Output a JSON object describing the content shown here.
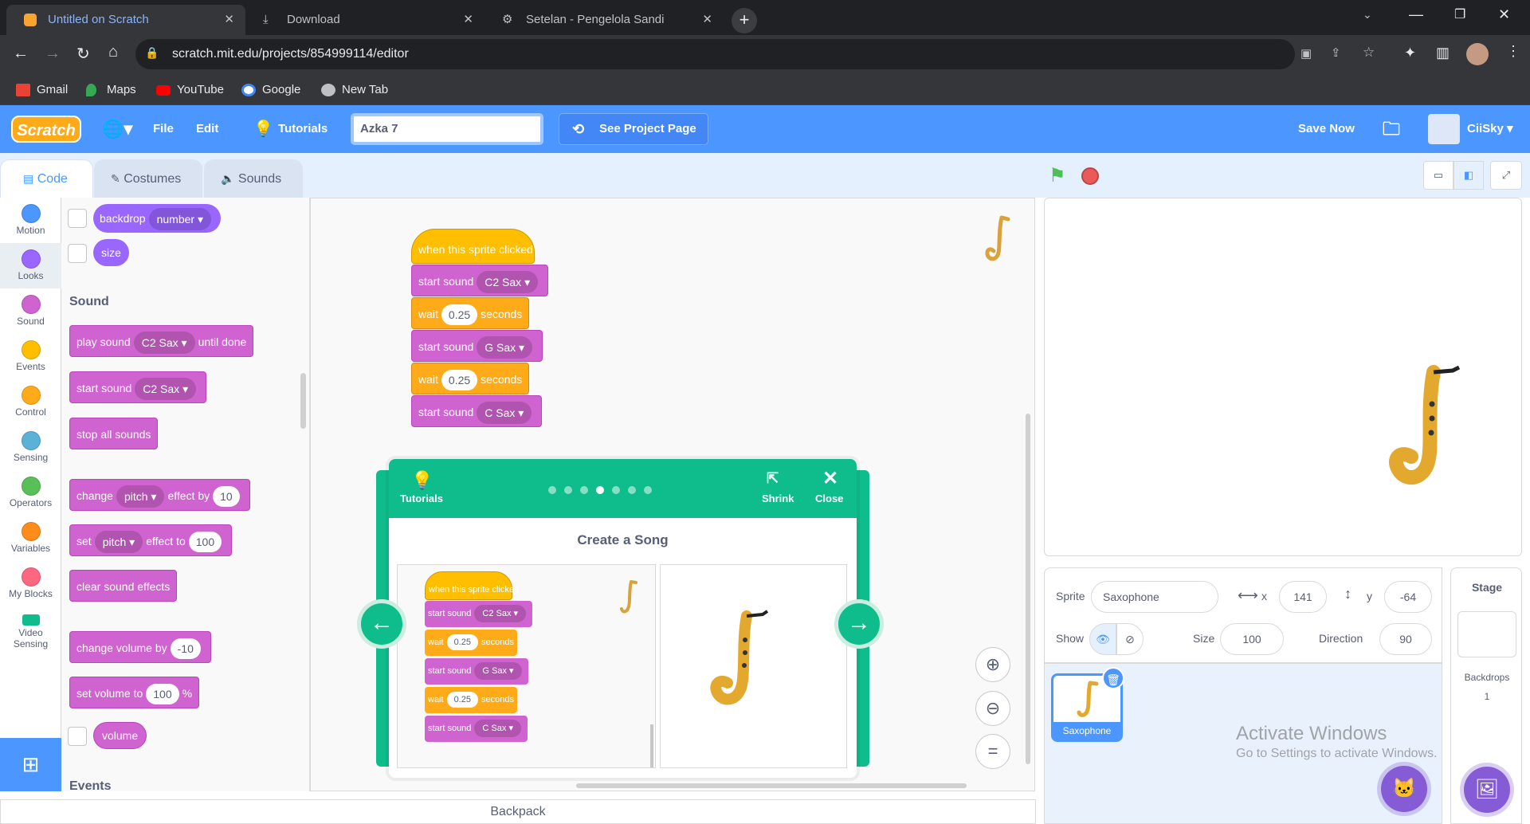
{
  "browser": {
    "tabs": [
      {
        "title": "Untitled on Scratch",
        "active": true
      },
      {
        "title": "Download",
        "active": false
      },
      {
        "title": "Setelan - Pengelola Sandi",
        "active": false
      }
    ],
    "url": "scratch.mit.edu/projects/854999114/editor",
    "bookmarks": [
      "Gmail",
      "Maps",
      "YouTube",
      "Google",
      "New Tab"
    ]
  },
  "menu": {
    "logo": "Scratch",
    "file": "File",
    "edit": "Edit",
    "tutorials": "Tutorials",
    "project_title": "Azka 7",
    "see_project_page": "See Project Page",
    "save_now": "Save Now",
    "username": "CiiSky"
  },
  "editor_tabs": [
    "Code",
    "Costumes",
    "Sounds"
  ],
  "categories": [
    {
      "label": "Motion",
      "color": "#4c97ff"
    },
    {
      "label": "Looks",
      "color": "#9966ff"
    },
    {
      "label": "Sound",
      "color": "#cf63cf"
    },
    {
      "label": "Events",
      "color": "#ffbf00"
    },
    {
      "label": "Control",
      "color": "#ffab19"
    },
    {
      "label": "Sensing",
      "color": "#5cb1d6"
    },
    {
      "label": "Operators",
      "color": "#59c059"
    },
    {
      "label": "Variables",
      "color": "#ff8c1a"
    },
    {
      "label": "My Blocks",
      "color": "#ff6680"
    },
    {
      "label": "Video Sensing",
      "color": "#0fbd8c"
    }
  ],
  "palette": {
    "backdrop": "backdrop",
    "backdrop_dropdown": "number",
    "size": "size",
    "sound_heading": "Sound",
    "play_sound": "play sound",
    "play_sound_value": "C2 Sax",
    "until_done": "until done",
    "start_sound": "start sound",
    "start_sound_value": "C2 Sax",
    "stop_all_sounds": "stop all sounds",
    "change": "change",
    "pitch": "pitch",
    "effect_by": "effect by",
    "effect_by_value": "10",
    "set": "set",
    "effect_to": "effect to",
    "effect_to_value": "100",
    "clear_sound_effects": "clear sound effects",
    "change_volume_by": "change volume by",
    "change_volume_value": "-10",
    "set_volume_to": "set volume to",
    "set_volume_value": "100",
    "percent": "%",
    "volume": "volume",
    "events_heading": "Events"
  },
  "script": {
    "hat": "when this sprite clicked",
    "start_sound": "start sound",
    "wait": "wait",
    "seconds": "seconds",
    "sound1": "C2 Sax",
    "wait1": "0.25",
    "sound2": "G Sax",
    "wait2": "0.25",
    "sound3": "C Sax"
  },
  "tutorial": {
    "tutorials_label": "Tutorials",
    "shrink_label": "Shrink",
    "close_label": "Close",
    "title": "Create a Song",
    "steps": 7,
    "current_step": 4
  },
  "sprite_info": {
    "sprite_label": "Sprite",
    "sprite_name": "Saxophone",
    "x_label": "x",
    "x_value": "141",
    "y_label": "y",
    "y_value": "-64",
    "show_label": "Show",
    "size_label": "Size",
    "size_value": "100",
    "direction_label": "Direction",
    "direction_value": "90"
  },
  "sprites": [
    {
      "name": "Saxophone"
    }
  ],
  "stage_panel": {
    "title": "Stage",
    "backdrops_label": "Backdrops",
    "backdrops_count": "1"
  },
  "backpack": "Backpack",
  "watermark": {
    "line1": "Activate Windows",
    "line2": "Go to Settings to activate Windows."
  }
}
